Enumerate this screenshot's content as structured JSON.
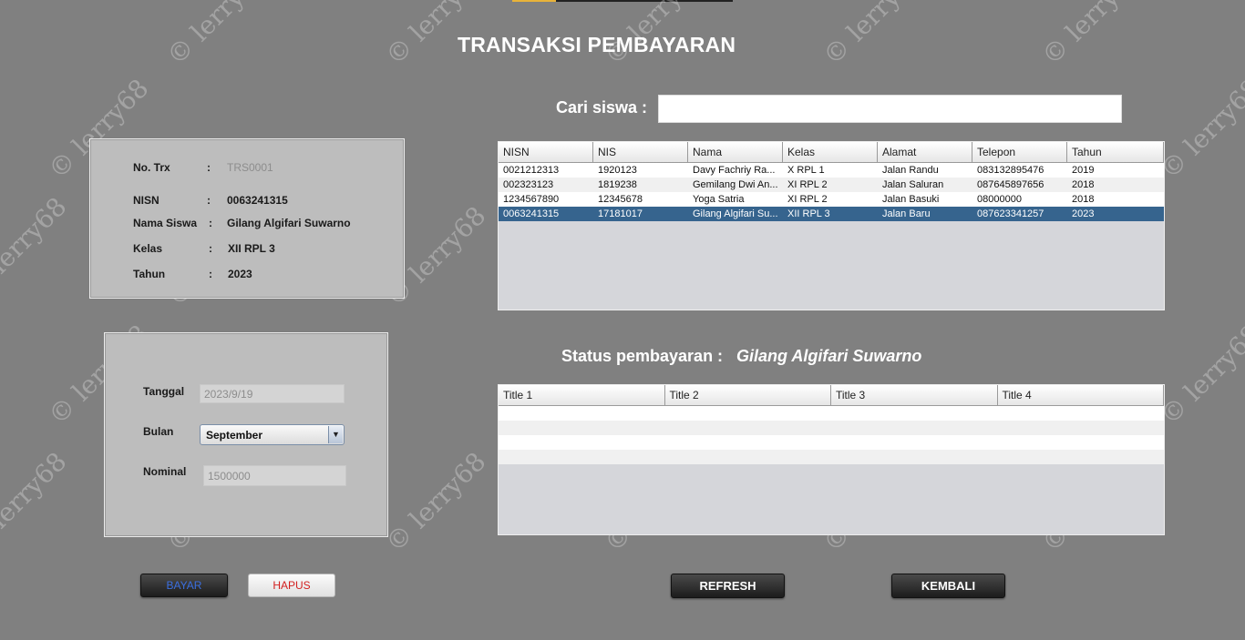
{
  "title": "TRANSAKSI PEMBAYARAN",
  "info": {
    "notrx_label": "No. Trx",
    "notrx_value": "TRS0001",
    "nisn_label": "NISN",
    "nisn_value": "0063241315",
    "nama_label": "Nama Siswa",
    "nama_value": "Gilang Algifari Suwarno",
    "kelas_label": "Kelas",
    "kelas_value": "XII RPL 3",
    "tahun_label": "Tahun",
    "tahun_value": "2023",
    "colon": ":"
  },
  "form": {
    "tanggal_label": "Tanggal",
    "tanggal_value": "2023/9/19",
    "bulan_label": "Bulan",
    "bulan_selected": "September",
    "nominal_label": "Nominal",
    "nominal_value": "1500000"
  },
  "search": {
    "label": "Cari siswa :",
    "value": ""
  },
  "students": {
    "columns": [
      "NISN",
      "NIS",
      "Nama",
      "Kelas",
      "Alamat",
      "Telepon",
      "Tahun"
    ],
    "rows": [
      [
        "0021212313",
        "1920123",
        "Davy Fachriy Ra...",
        "X RPL 1",
        "Jalan Randu",
        "083132895476",
        "2019"
      ],
      [
        "002323123",
        "1819238",
        "Gemilang Dwi An...",
        "XI RPL 2",
        "Jalan Saluran",
        "087645897656",
        "2018"
      ],
      [
        "1234567890",
        "12345678",
        "Yoga Satria",
        "XI RPL 2",
        "Jalan Basuki",
        "08000000",
        "2018"
      ],
      [
        "0063241315",
        "17181017",
        "Gilang Algifari Su...",
        "XII RPL 3",
        "Jalan Baru",
        "087623341257",
        "2023"
      ]
    ],
    "selected_row": 3
  },
  "status": {
    "label": "Status pembayaran :",
    "student_name": "Gilang Algifari Suwarno",
    "columns": [
      "Title 1",
      "Title 2",
      "Title 3",
      "Title 4"
    ],
    "empty_rows": 4
  },
  "buttons": {
    "bayar": "BAYAR",
    "hapus": "HAPUS",
    "refresh": "REFRESH",
    "kembali": "KEMBALI"
  },
  "watermark": "© lerry68",
  "colors": {
    "background": "#808080",
    "selected_row": "#36648e",
    "bayar_text": "#3b6fe0",
    "hapus_text": "#d21f1f"
  }
}
